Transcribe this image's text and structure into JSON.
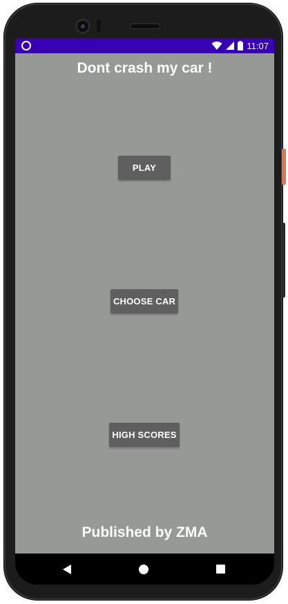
{
  "status_bar": {
    "time": "11:07",
    "background_color": "#3700b3",
    "icons": [
      "app-notification-icon",
      "wifi-icon",
      "signal-icon",
      "battery-icon"
    ]
  },
  "app": {
    "title": "Dont crash my car !",
    "background_color": "#979997",
    "buttons": {
      "play": "PLAY",
      "choose_car": "CHOOSE CAR",
      "high_scores": "HIGH SCORES"
    },
    "button_color": "#5f5f5f",
    "footer": "Published by ZMA"
  },
  "nav_bar": {
    "icons": [
      "back-icon",
      "home-icon",
      "recents-icon"
    ]
  }
}
